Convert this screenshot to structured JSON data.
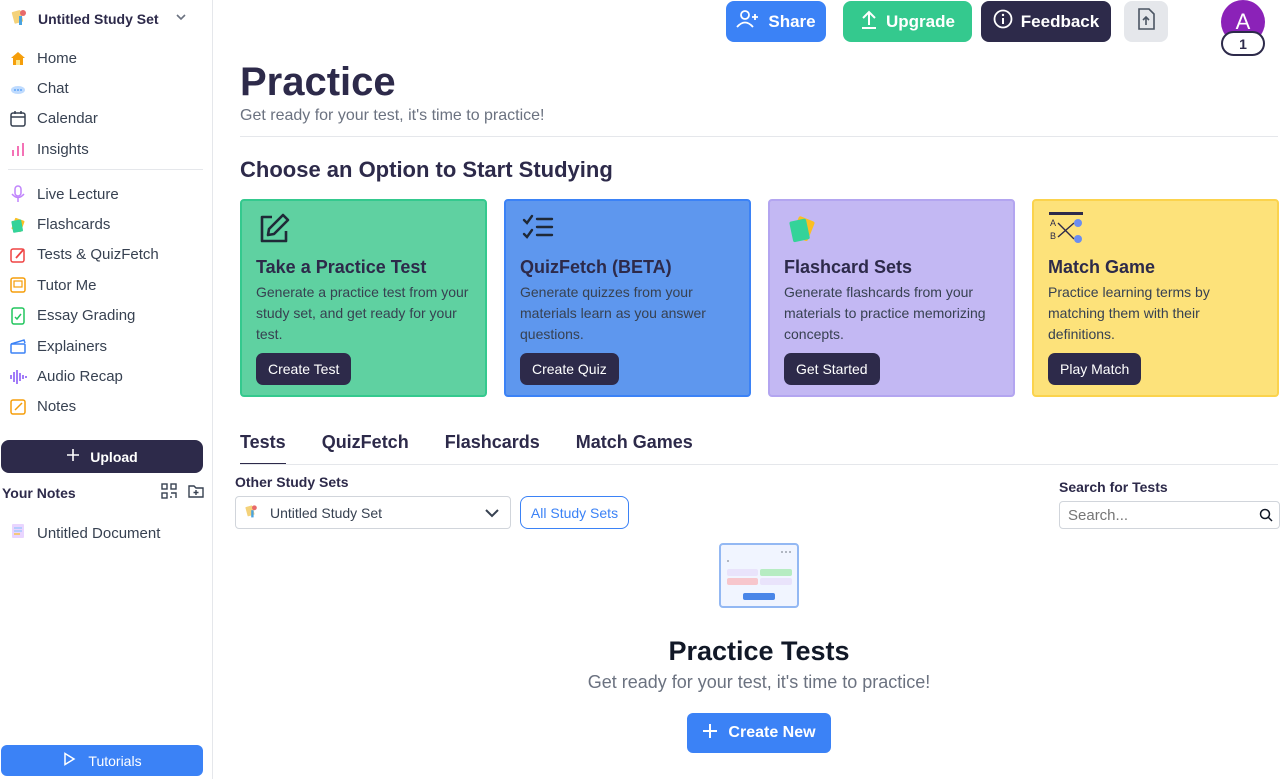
{
  "sidebar": {
    "study_set_name": "Untitled Study Set",
    "nav_primary": [
      {
        "label": "Home",
        "icon": "home-icon"
      },
      {
        "label": "Chat",
        "icon": "chat-icon"
      },
      {
        "label": "Calendar",
        "icon": "calendar-icon"
      },
      {
        "label": "Insights",
        "icon": "insights-icon"
      }
    ],
    "nav_tools": [
      {
        "label": "Live Lecture",
        "icon": "microphone-icon"
      },
      {
        "label": "Flashcards",
        "icon": "flashcards-icon"
      },
      {
        "label": "Tests & QuizFetch",
        "icon": "tests-icon"
      },
      {
        "label": "Tutor Me",
        "icon": "tutor-icon"
      },
      {
        "label": "Essay Grading",
        "icon": "essay-icon"
      },
      {
        "label": "Explainers",
        "icon": "clapper-icon"
      },
      {
        "label": "Audio Recap",
        "icon": "audio-wave-icon"
      },
      {
        "label": "Notes",
        "icon": "notes-icon"
      }
    ],
    "upload_label": "Upload",
    "your_notes_label": "Your Notes",
    "documents": [
      {
        "label": "Untitled Document"
      }
    ],
    "tutorials_label": "Tutorials"
  },
  "topbar": {
    "share_label": "Share",
    "upgrade_label": "Upgrade",
    "feedback_label": "Feedback",
    "avatar_initial": "A",
    "avatar_badge": "1"
  },
  "main": {
    "title": "Practice",
    "subtitle": "Get ready for your test, it's time to practice!",
    "section_title": "Choose an Option to Start Studying",
    "cards": [
      {
        "title": "Take a Practice Test",
        "description": "Generate a practice test from your study set, and get ready for your test.",
        "button": "Create Test"
      },
      {
        "title": "QuizFetch (BETA)",
        "description": "Generate quizzes from your materials learn as you answer questions.",
        "button": "Create Quiz"
      },
      {
        "title": "Flashcard Sets",
        "description": "Generate flashcards from your materials to practice memorizing concepts.",
        "button": "Get Started"
      },
      {
        "title": "Match Game",
        "description": "Practice learning terms by matching them with their definitions.",
        "button": "Play Match"
      }
    ],
    "tabs": [
      {
        "label": "Tests",
        "active": true
      },
      {
        "label": "QuizFetch",
        "active": false
      },
      {
        "label": "Flashcards",
        "active": false
      },
      {
        "label": "Match Games",
        "active": false
      }
    ],
    "other_study_sets_label": "Other Study Sets",
    "selected_study_set": "Untitled Study Set",
    "all_study_sets_label": "All Study Sets",
    "search_label": "Search for Tests",
    "search_placeholder": "Search...",
    "empty_title": "Practice Tests",
    "empty_subtitle": "Get ready for your test, it's time to practice!",
    "create_new_label": "Create New"
  },
  "colors": {
    "brand_dark": "#2d2a4a",
    "blue": "#3b82f6",
    "green": "#34c98e",
    "purple_card": "#c3b8f3",
    "yellow_card": "#fde27a",
    "avatar": "#8b22b8"
  }
}
